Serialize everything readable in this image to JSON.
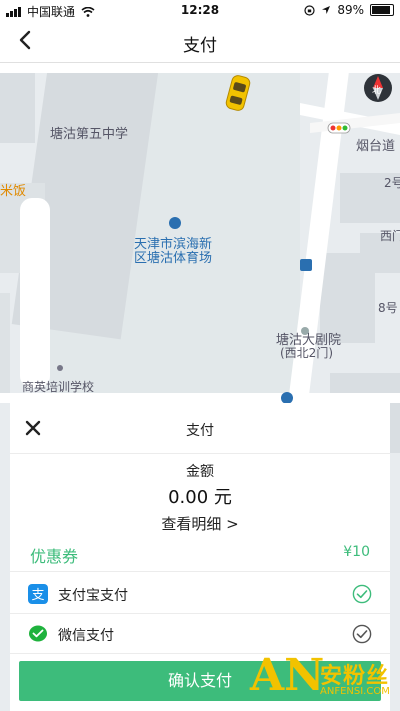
{
  "status_bar": {
    "carrier": "中国联通",
    "time": "12:28",
    "battery": "89%",
    "battery_level": 0.89
  },
  "nav": {
    "title": "支付",
    "back_icon": "chevron-left-icon"
  },
  "map": {
    "labels": {
      "school_5": "塘沽第五中学",
      "stadium_line1": "天津市滨海新",
      "stadium_line2": "区塘沽体育场",
      "road": "烟台道",
      "theater_line1": "塘沽大剧院",
      "theater_line2": "(西北2门)",
      "training_school": "商英培训学校",
      "rice": "米饭",
      "west_gate": "西门",
      "gate_2": "2号",
      "gate_8": "8号"
    },
    "compass_label": "北"
  },
  "sheet": {
    "title": "支付",
    "amount_label": "金额",
    "amount_value": "0.00 元",
    "detail_link": "查看明细 >",
    "coupon_label": "优惠券",
    "coupon_value": "¥10",
    "methods": [
      {
        "label": "支付宝支付",
        "icon": "alipay-icon",
        "selected": true
      },
      {
        "label": "微信支付",
        "icon": "wechat-pay-icon",
        "selected": false
      }
    ],
    "confirm_label": "确认支付"
  },
  "watermark": {
    "logo": "AN",
    "cn": "安粉丝",
    "en": "ANFENSI.COM"
  },
  "colors": {
    "accent": "#3dbc7b",
    "map_bg": "#e8ecef",
    "road": "#ffffff",
    "block": "#d8dde1"
  }
}
